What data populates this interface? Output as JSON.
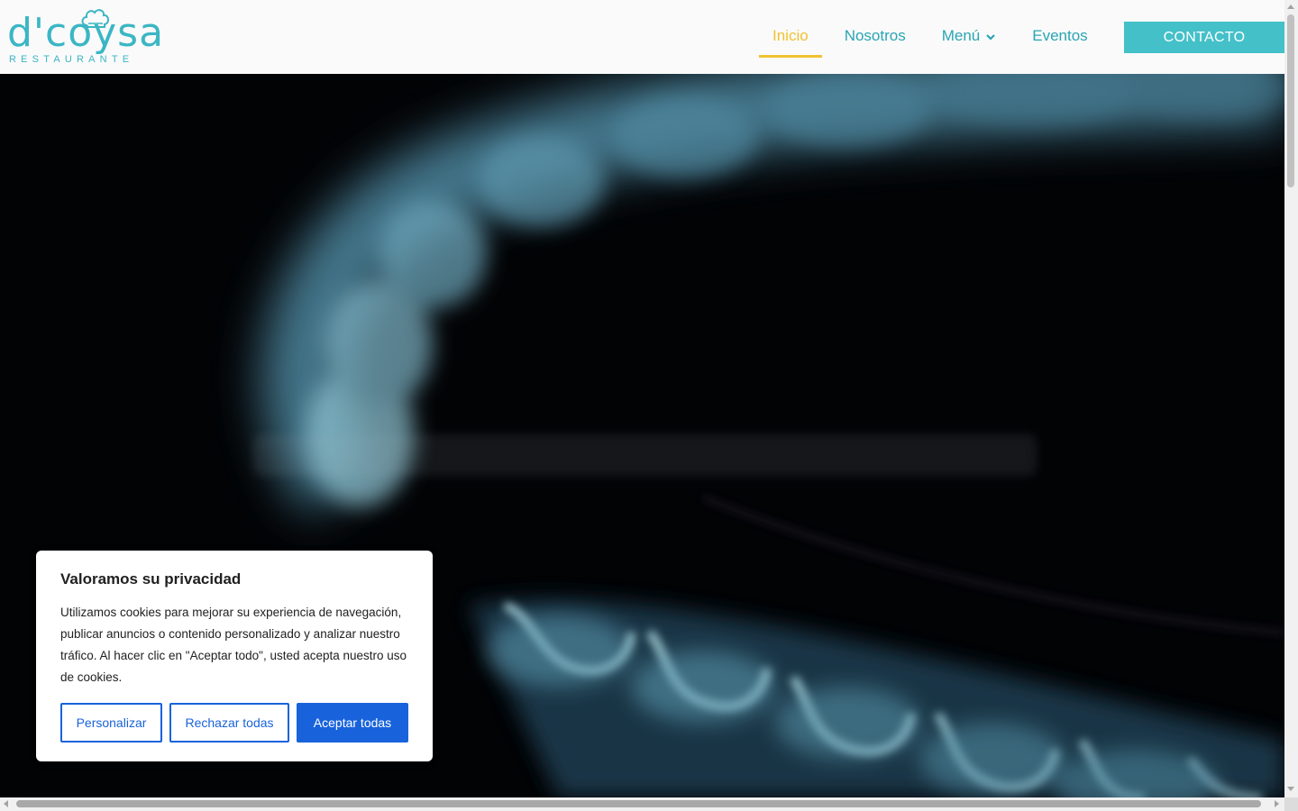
{
  "brand": {
    "name": "d'coysa",
    "tagline": "RESTAURANTE"
  },
  "nav": {
    "items": [
      {
        "label": "Inicio",
        "active": true
      },
      {
        "label": "Nosotros",
        "active": false
      },
      {
        "label": "Menú",
        "active": false,
        "has_dropdown": true
      },
      {
        "label": "Eventos",
        "active": false
      }
    ],
    "contact_label": "CONTACTO"
  },
  "cookie": {
    "title": "Valoramos su privacidad",
    "text": "Utilizamos cookies para mejorar su experiencia de navegación, publicar anuncios o contenido personalizado y analizar nuestro tráfico. Al hacer clic en \"Aceptar todo\", usted acepta nuestro uso de cookies.",
    "customize_label": "Personalizar",
    "reject_label": "Rechazar todas",
    "accept_label": "Aceptar todas"
  },
  "colors": {
    "brand": "#3bb6c4",
    "active": "#f1c232",
    "contact_button": "#44c0c9",
    "cookie_button": "#1863dc"
  },
  "icons": [
    "chef-hat-icon",
    "chevron-down-icon"
  ]
}
